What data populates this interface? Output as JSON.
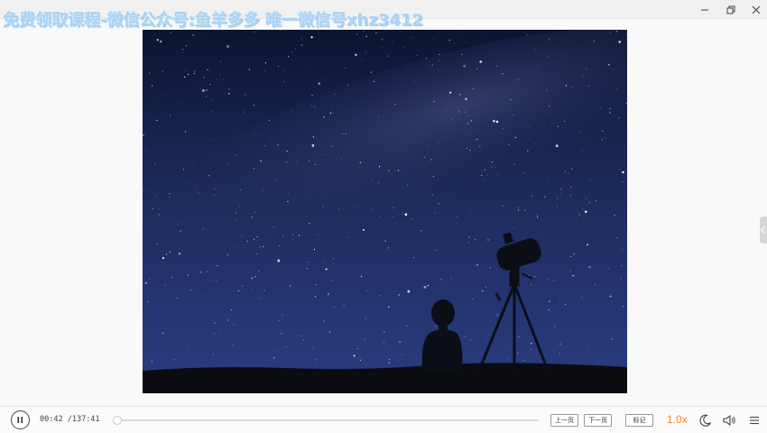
{
  "watermark": {
    "text": "免费领取课程-微信公众号:鱼羊多多 唯一微信号xhz3412"
  },
  "window_controls": {
    "minimize": "minimize-icon",
    "restore": "restore-icon",
    "close": "close-icon"
  },
  "player": {
    "current_time": "00:42",
    "total_time": "/137:41",
    "progress_fraction": 0.005,
    "prev_page_label": "上一页",
    "next_page_label": "下一页",
    "bookmark_label": "标记",
    "speed": "1.0x",
    "accent_color": "#f08a24"
  },
  "slide": {
    "description_icon": "starry-sky-telescope-image"
  }
}
